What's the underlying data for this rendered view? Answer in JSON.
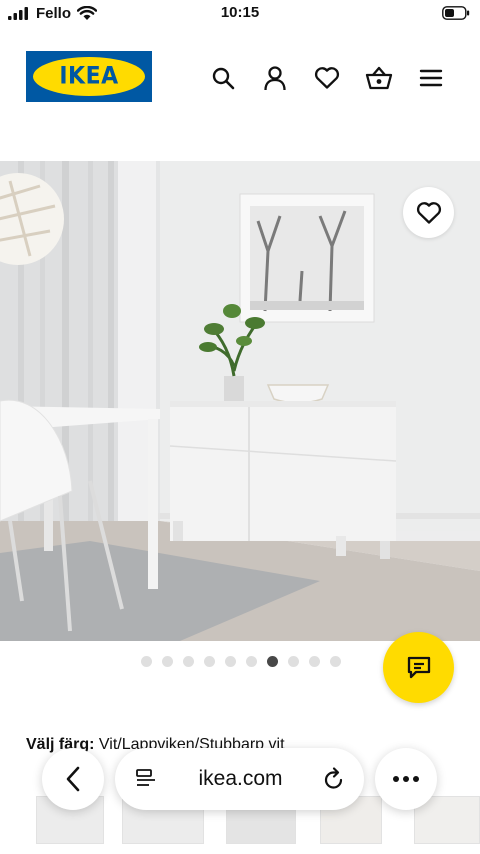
{
  "status_bar": {
    "carrier": "Fello",
    "time": "10:15"
  },
  "header": {
    "logo_text": "IKEA",
    "icons": [
      "search-icon",
      "profile-icon",
      "heart-icon",
      "basket-icon",
      "menu-icon"
    ]
  },
  "product": {
    "image_dot_count": 10,
    "active_dot": 7
  },
  "colour": {
    "label": "Välj färg:",
    "value": "Vit/Lappviken/Stubbarp vit"
  },
  "browser": {
    "url": "ikea.com",
    "back_icon": "chevron-left-icon",
    "reader_icon": "reader-icon",
    "reload_icon": "reload-icon",
    "more_icon": "more-icon"
  },
  "colors": {
    "ikea_blue": "#0058a3",
    "ikea_yellow": "#ffdb00",
    "dot_active": "#484848",
    "dot_inactive": "#dfdfdf"
  }
}
